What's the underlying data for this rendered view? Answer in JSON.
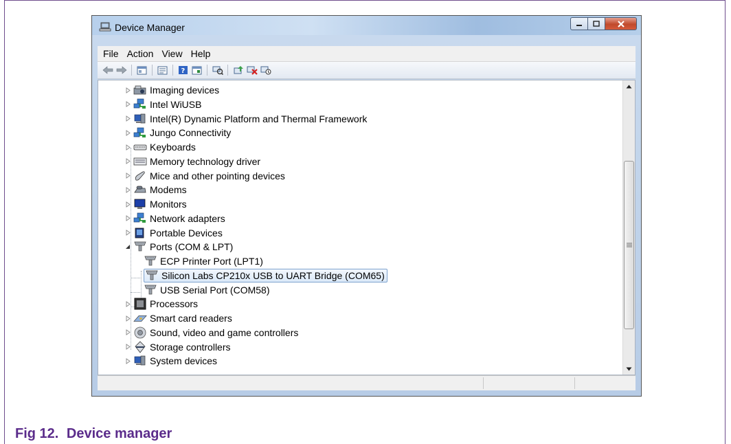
{
  "window": {
    "title": "Device Manager"
  },
  "menu": [
    "File",
    "Action",
    "View",
    "Help"
  ],
  "toolbar_icons": [
    "back-icon",
    "forward-icon",
    "sep",
    "show-hide-console-tree-icon",
    "sep",
    "properties-icon",
    "sep",
    "help-icon",
    "view-icon",
    "sep",
    "scan-hardware-icon",
    "sep",
    "update-driver-icon",
    "uninstall-icon",
    "disable-icon"
  ],
  "tree": [
    {
      "label": "Imaging devices",
      "icon": "camera-icon",
      "level": 0,
      "expander": "collapsed"
    },
    {
      "label": "Intel WiUSB",
      "icon": "network-icon",
      "level": 0,
      "expander": "collapsed"
    },
    {
      "label": "Intel(R) Dynamic Platform and Thermal Framework",
      "icon": "computer-icon",
      "level": 0,
      "expander": "collapsed"
    },
    {
      "label": "Jungo Connectivity",
      "icon": "network-icon",
      "level": 0,
      "expander": "collapsed"
    },
    {
      "label": "Keyboards",
      "icon": "keyboard-icon",
      "level": 0,
      "expander": "collapsed"
    },
    {
      "label": "Memory technology driver",
      "icon": "memory-icon",
      "level": 0,
      "expander": "collapsed"
    },
    {
      "label": "Mice and other pointing devices",
      "icon": "mouse-icon",
      "level": 0,
      "expander": "collapsed"
    },
    {
      "label": "Modems",
      "icon": "modem-icon",
      "level": 0,
      "expander": "collapsed"
    },
    {
      "label": "Monitors",
      "icon": "monitor-icon",
      "level": 0,
      "expander": "collapsed"
    },
    {
      "label": "Network adapters",
      "icon": "network-icon",
      "level": 0,
      "expander": "collapsed"
    },
    {
      "label": "Portable Devices",
      "icon": "portable-device-icon",
      "level": 0,
      "expander": "collapsed"
    },
    {
      "label": "Ports (COM & LPT)",
      "icon": "port-icon",
      "level": 0,
      "expander": "expanded"
    },
    {
      "label": "ECP Printer Port (LPT1)",
      "icon": "port-icon",
      "level": 1,
      "expander": "none"
    },
    {
      "label": "Silicon Labs CP210x USB to UART Bridge (COM65)",
      "icon": "port-icon",
      "level": 1,
      "expander": "none",
      "selected": true
    },
    {
      "label": "USB Serial Port (COM58)",
      "icon": "port-icon",
      "level": 1,
      "expander": "none"
    },
    {
      "label": "Processors",
      "icon": "processor-icon",
      "level": 0,
      "expander": "collapsed"
    },
    {
      "label": "Smart card readers",
      "icon": "smart-card-icon",
      "level": 0,
      "expander": "collapsed"
    },
    {
      "label": "Sound, video and game controllers",
      "icon": "speaker-icon",
      "level": 0,
      "expander": "collapsed"
    },
    {
      "label": "Storage controllers",
      "icon": "storage-icon",
      "level": 0,
      "expander": "collapsed"
    },
    {
      "label": "System devices",
      "icon": "computer-icon",
      "level": 0,
      "expander": "collapsed"
    }
  ],
  "caption": {
    "number": "Fig 12.",
    "text": "Device manager"
  },
  "colors": {
    "caption": "#5b2c8b",
    "selection_border": "#7da2ce"
  }
}
